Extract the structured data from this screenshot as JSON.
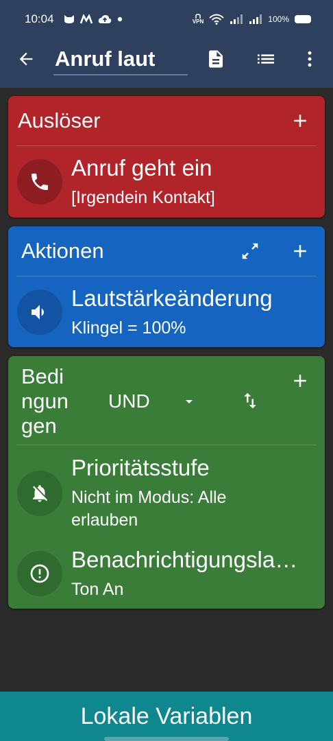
{
  "status_bar": {
    "time": "10:04",
    "battery": "100%",
    "vpn": "VPN"
  },
  "app_bar": {
    "title": "Anruf laut"
  },
  "colors": {
    "app_bar": "#2f3f5e",
    "trigger_card": "#b0242a",
    "action_card": "#1565c0",
    "condition_card": "#3a7d39",
    "bottom_bar": "#0e878f"
  },
  "triggers": {
    "header": "Auslöser",
    "items": [
      {
        "title": "Anruf geht ein",
        "subtitle": "[Irgendein Kontakt]",
        "icon": "phone-icon"
      }
    ]
  },
  "actions": {
    "header": "Aktionen",
    "items": [
      {
        "title": "Lautstärkeänderung",
        "subtitle": "Klingel = 100%",
        "icon": "volume-icon"
      }
    ]
  },
  "conditions": {
    "header": "Bedi\nngun\ngen",
    "logic": "UND",
    "items": [
      {
        "title": "Prioritätsstufe",
        "subtitle": "Nicht im Modus: Alle erlauben",
        "icon": "bell-off-icon"
      },
      {
        "title": "Benachrichtigungslautstärke",
        "subtitle": "Ton An",
        "icon": "alert-circle-icon"
      }
    ]
  },
  "bottom_bar": {
    "label": "Lokale Variablen"
  }
}
